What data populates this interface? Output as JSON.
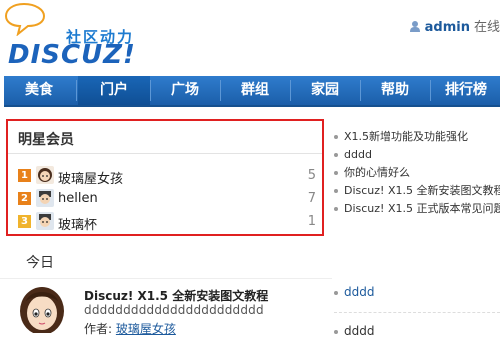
{
  "brand": {
    "name_cn": "社区动力",
    "name_en": "DISCUZ!",
    "color": "#1c63bb"
  },
  "user": {
    "name": "admin",
    "status": "在线"
  },
  "nav": {
    "items": [
      {
        "label": "美食"
      },
      {
        "label": "门户"
      },
      {
        "label": "广场"
      },
      {
        "label": "群组"
      },
      {
        "label": "家园"
      },
      {
        "label": "帮助"
      },
      {
        "label": "排行榜"
      }
    ],
    "active_index": 1,
    "color": "#2f7ccd"
  },
  "star_members": {
    "title": "明星会员",
    "members": [
      {
        "rank": "1",
        "name": "玻璃屋女孩",
        "count": "5",
        "rank_color": "#e8811a"
      },
      {
        "rank": "2",
        "name": "hellen",
        "count": "7",
        "rank_color": "#e8811a"
      },
      {
        "rank": "3",
        "name": "玻璃杯",
        "count": "1",
        "rank_color": "#f0b32c"
      }
    ],
    "border_color": "#e02020"
  },
  "news": {
    "items": [
      "X1.5新增功能及功能强化",
      "dddd",
      "你的心情好么",
      "Discuz! X1.5 全新安装图文教程",
      "Discuz! X1.5 正式版本常见问题"
    ]
  },
  "today": {
    "title": "今日",
    "headline": "Discuz! X1.5 全新安装图文教程",
    "summary": "ddddddddddddddddddddddd",
    "author_label": "作者:",
    "author": "玻璃屋女孩"
  },
  "right_lower": {
    "item1": "dddd",
    "item2": "dddd"
  }
}
